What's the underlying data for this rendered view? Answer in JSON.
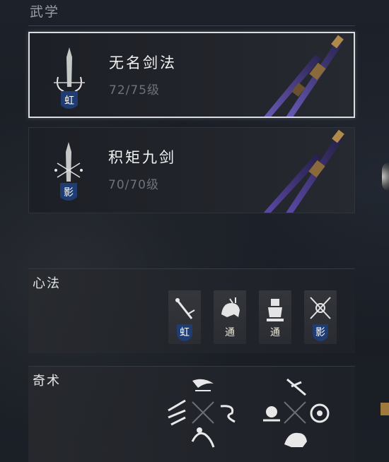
{
  "section": {
    "title": "武学"
  },
  "skills": [
    {
      "name": "无名剑法",
      "level": "72/75级",
      "badge": "虹"
    },
    {
      "name": "积矩九剑",
      "level": "70/70级",
      "badge": "影"
    }
  ],
  "xinfa": {
    "title": "心法",
    "slots": [
      {
        "badge": "虹",
        "icon": "sword-hilt-icon"
      },
      {
        "badge": "通",
        "icon": "beast-icon"
      },
      {
        "badge": "通",
        "icon": "statue-icon"
      },
      {
        "badge": "影",
        "icon": "twin-blades-icon"
      }
    ]
  },
  "qishu": {
    "title": "奇术",
    "clusters": [
      {
        "icons": [
          "claw-icon",
          "arrows-icon",
          "swirl-icon",
          "leap-icon"
        ]
      },
      {
        "icons": [
          "strike-icon",
          "fist-icon",
          "circle-palm-icon",
          "horse-icon"
        ]
      }
    ]
  },
  "colors": {
    "badge_blue": "#1f3d72",
    "sword_purple": "#4a3a8a",
    "selected_border": "#d8dbe0"
  }
}
